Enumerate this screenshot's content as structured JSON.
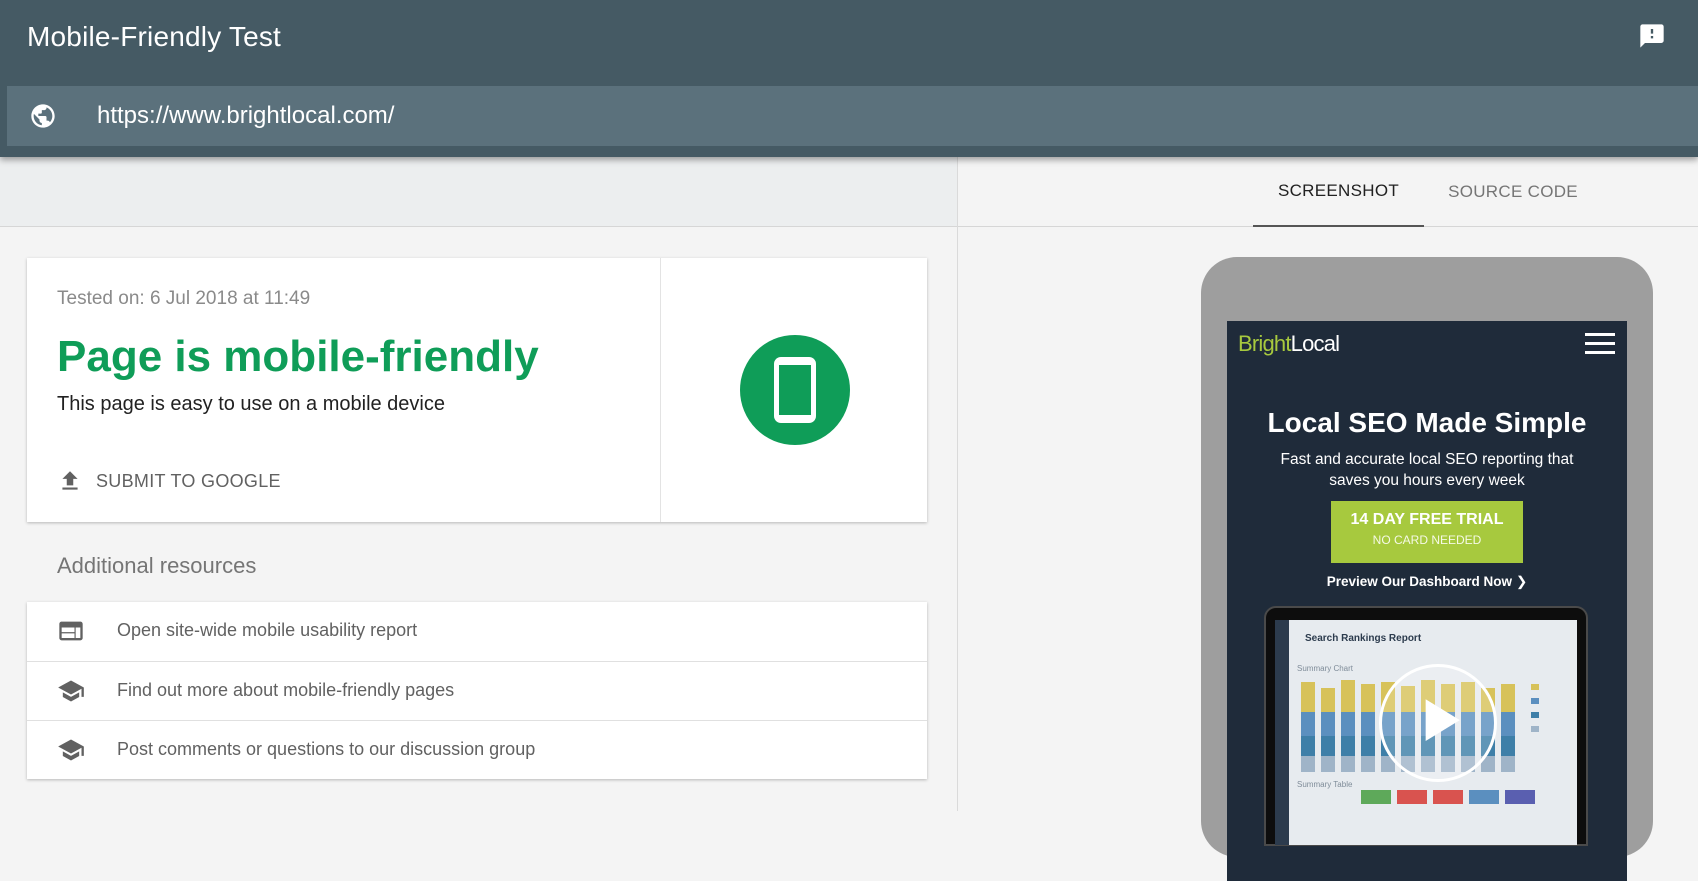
{
  "header": {
    "title": "Mobile-Friendly Test",
    "url_value": "https://www.brightlocal.com/",
    "feedback_icon": "feedback-icon",
    "globe_icon": "globe-icon"
  },
  "result": {
    "tested_on": "Tested on: 6 Jul 2018 at 11:49",
    "verdict": "Page is mobile-friendly",
    "subtext": "This page is easy to use on a mobile device",
    "submit_label": "SUBMIT TO GOOGLE",
    "status_color": "#0f9d58"
  },
  "resources": {
    "heading": "Additional resources",
    "items": [
      {
        "label": "Open site-wide mobile usability report",
        "icon": "web-report-icon"
      },
      {
        "label": "Find out more about mobile-friendly pages",
        "icon": "school-icon"
      },
      {
        "label": "Post comments or questions to our discussion group",
        "icon": "school-icon"
      }
    ]
  },
  "tabs": [
    {
      "label": "SCREENSHOT",
      "active": true
    },
    {
      "label": "SOURCE CODE",
      "active": false
    }
  ],
  "preview": {
    "logo_part1": "Bright",
    "logo_part2": "Local",
    "headline": "Local SEO Made Simple",
    "subline": "Fast and accurate local SEO reporting that saves you hours every week",
    "cta_main": "14 DAY FREE TRIAL",
    "cta_sub": "NO CARD NEEDED",
    "preview_link": "Preview Our Dashboard Now",
    "laptop_title": "Search Rankings Report",
    "laptop_section1": "Summary Chart",
    "laptop_section2": "Summary Table",
    "brand_green": "#a7c93e",
    "bg_navy": "#1f2b3a"
  }
}
